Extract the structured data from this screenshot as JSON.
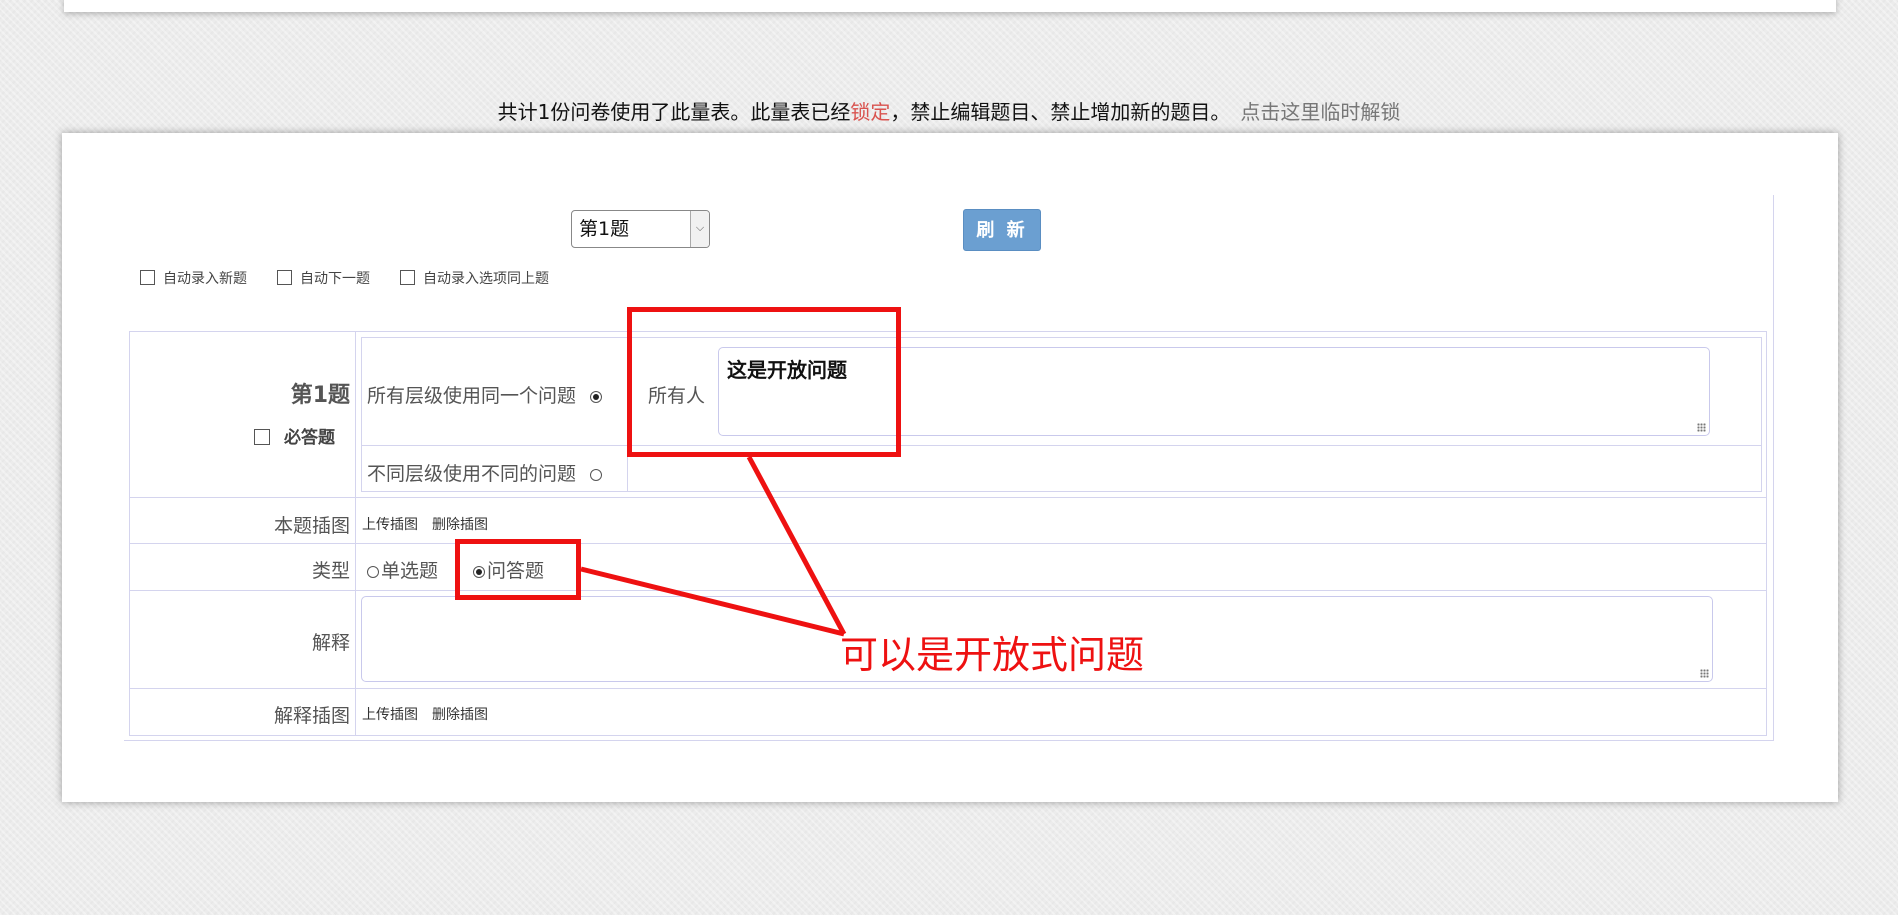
{
  "notice": {
    "before": "共计1份问卷使用了此量表。此量表已经",
    "locked": "锁定",
    "after": "，禁止编辑题目、禁止增加新的题目。",
    "unlock_link": "点击这里临时解锁"
  },
  "toolbar": {
    "question_select": "第1题",
    "refresh_label": "刷 新",
    "options": [
      "自动录入新题",
      "自动下一题",
      "自动录入选项同上题"
    ]
  },
  "question": {
    "number": "第1题",
    "required_label": "必答题",
    "same_question_label": "所有层级使用同一个问题",
    "different_question_label": "不同层级使用不同的问题",
    "audience_label": "所有人",
    "question_text": "这是开放问题",
    "image_label": "本题插图",
    "upload_image": "上传插图",
    "delete_image": "删除插图",
    "type_label": "类型",
    "type_options": [
      "单选题",
      "问答题"
    ],
    "type_selected": "问答题",
    "explanation_label": "解释",
    "explanation_value": "",
    "explanation_image_label": "解释插图",
    "explanation_upload_image": "上传插图",
    "explanation_delete_image": "删除插图"
  },
  "annotation": {
    "text": "可以是开放式问题",
    "color": "#ee1111"
  },
  "colors": {
    "refresh_button": "#6b9fd1",
    "locked_text": "#d9534f",
    "table_border": "#d4d4ee"
  }
}
